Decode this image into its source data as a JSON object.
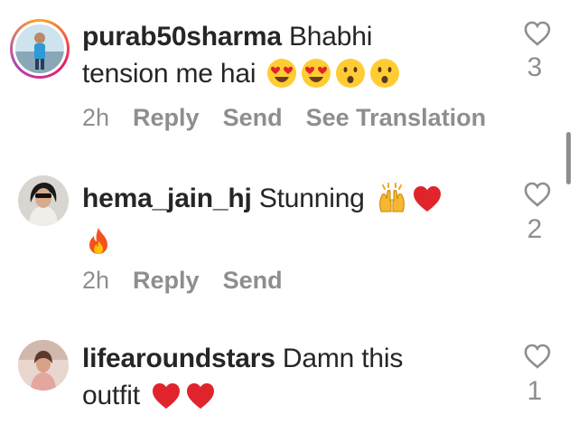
{
  "comments": [
    {
      "username": "purab50sharma",
      "text_line1": "Bhabhi",
      "text_line2": "tension me hai",
      "emojis": [
        "heart-eyes-emoji-icon",
        "heart-eyes-emoji-icon",
        "surprised-emoji-icon",
        "surprised-emoji-icon"
      ],
      "likes": "3",
      "time": "2h",
      "reply": "Reply",
      "send": "Send",
      "see_translation": "See Translation"
    },
    {
      "username": "hema_jain_hj",
      "text": "Stunning",
      "emojis": [
        "raising-hands-emoji-icon",
        "red-heart-emoji-icon",
        "fire-emoji-icon"
      ],
      "likes": "2",
      "time": "2h",
      "reply": "Reply",
      "send": "Send"
    },
    {
      "username": "lifearoundstars",
      "text_line1": "Damn this",
      "text_line2": "outfit",
      "emojis": [
        "red-heart-emoji-icon",
        "red-heart-emoji-icon"
      ],
      "likes": "1"
    }
  ],
  "colors": {
    "text": "#262626",
    "secondary": "#8e8e8e",
    "heart_red": "#e0242c"
  }
}
